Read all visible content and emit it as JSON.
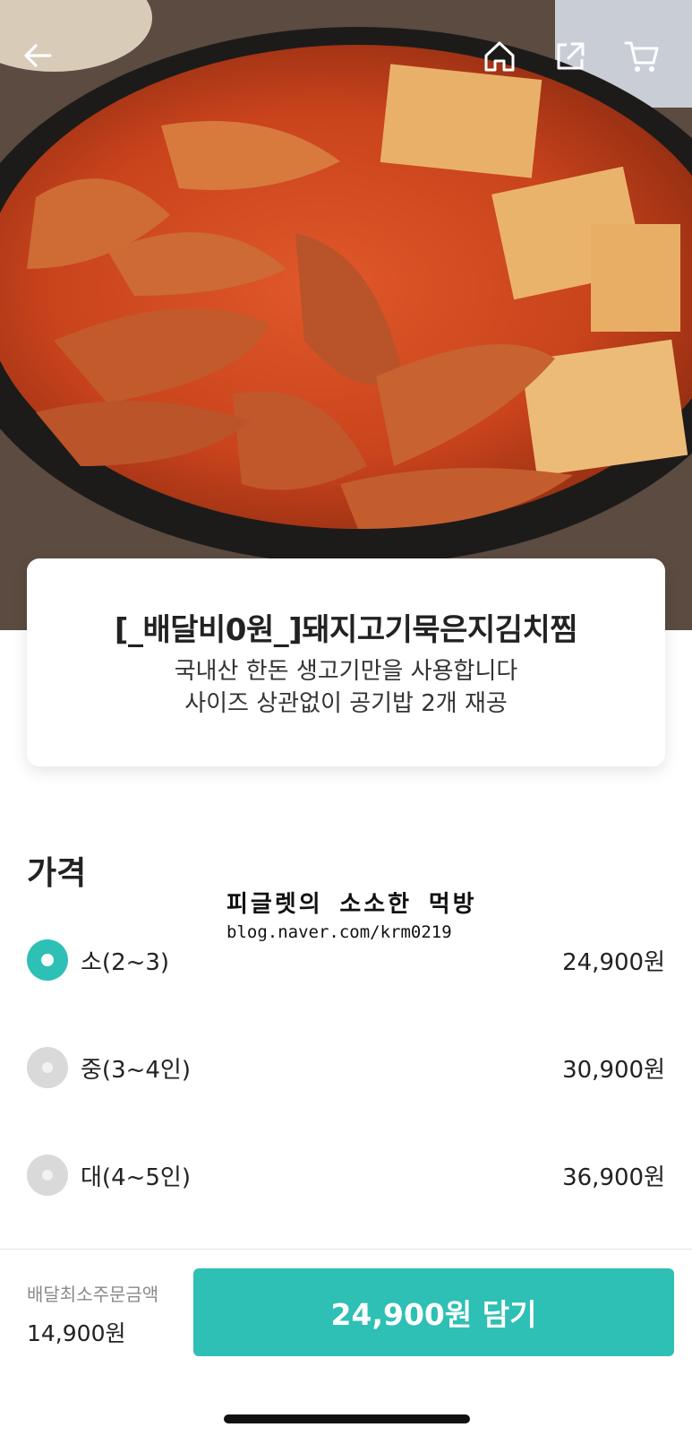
{
  "header": {
    "back_icon": "back-arrow-icon",
    "home_icon": "home-icon",
    "share_icon": "share-icon",
    "cart_icon": "cart-icon"
  },
  "hero": {
    "image": "spicy pork kimchi jjim with tofu in a black bowl"
  },
  "product": {
    "title": "[_배달비0원_]돼지고기묵은지김치찜",
    "description_line1": "국내산 한돈 생고기만을 사용합니다",
    "description_line2": "사이즈 상관없이 공기밥 2개 재공"
  },
  "watermark": {
    "line1": "피글렛의 소소한 먹방",
    "line2": "blog.naver.com/krm0219"
  },
  "price_section": {
    "title": "가격",
    "options": [
      {
        "label": "소(2~3)",
        "price": "24,900원",
        "selected": true
      },
      {
        "label": "중(3~4인)",
        "price": "30,900원",
        "selected": false
      },
      {
        "label": "대(4~5인)",
        "price": "36,900원",
        "selected": false
      }
    ]
  },
  "footer": {
    "min_order_label": "배달최소주문금액",
    "min_order_value": "14,900원",
    "cta_label": "24,900원 담기"
  },
  "colors": {
    "accent": "#2ebfb5",
    "radio_off": "#d9d9d9"
  }
}
